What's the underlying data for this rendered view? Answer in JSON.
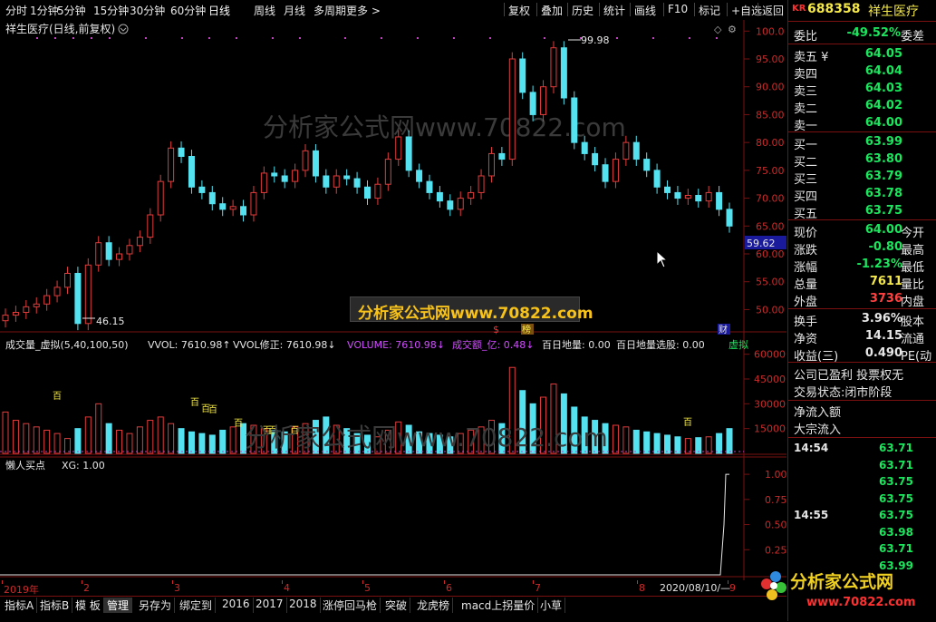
{
  "toolbar": {
    "left_items": [
      "分时",
      "1分钟",
      "5分钟",
      "15分钟",
      "30分钟",
      "60分钟",
      "日线",
      "周线",
      "月线",
      "多周期",
      "更多 >"
    ],
    "right_items": [
      "复权",
      "叠加",
      "历史",
      "统计",
      "画线",
      "F10",
      "标记",
      "+自选",
      "返回"
    ]
  },
  "main_chart": {
    "title": "祥生医疗(日线,前复权)",
    "y_ticks": [
      "100.0",
      "95.00",
      "90.00",
      "85.00",
      "80.00",
      "75.00",
      "70.00",
      "65.00",
      "60.00",
      "55.00",
      "50.00"
    ],
    "current_price_label": "59.62",
    "high_annotation": "99.98",
    "low_annotation": "46.15",
    "marker_dollar": "$",
    "marker_rank": "榜",
    "marker_cai": "财",
    "watermark_text": "分析家公式网www.70822.com"
  },
  "volume_chart": {
    "title": "成交量_虚拟(5,40,100,50)",
    "items": [
      {
        "text": "VVOL: 7610.98↑",
        "color": "#e6e6e6"
      },
      {
        "text": "VVOL修正: 7610.98↓",
        "color": "#e6e6e6"
      },
      {
        "text": "VOLUME: 7610.98↓",
        "color": "#d14cff"
      },
      {
        "text": "成交额_亿: 0.48↓",
        "color": "#d14cff"
      },
      {
        "text": "百日地量: 0.00",
        "color": "#e6e6e6"
      },
      {
        "text": "百日地量选股: 0.00",
        "color": "#e6e6e6"
      },
      {
        "text": "虚拟",
        "color": "#19e65c"
      }
    ],
    "y_ticks": [
      "60000",
      "45000",
      "30000",
      "15000"
    ],
    "marker_bai": "百"
  },
  "indicator_chart": {
    "title": "懒人买点",
    "value": "XG: 1.00",
    "y_ticks": [
      "1.00",
      "0.75",
      "0.50",
      "0.25"
    ]
  },
  "x_axis": {
    "labels": [
      "2019年",
      "2",
      "3",
      "4",
      "5",
      "6",
      "7",
      "8",
      "9"
    ],
    "cursor_date": "2020/08/10/—"
  },
  "chart_data": {
    "type": "candlestick",
    "title": "祥生医疗(日线,前复权)",
    "ylim": [
      46,
      102
    ],
    "close_series_approx": [
      49.0,
      49.5,
      50.5,
      51.0,
      52.5,
      54.0,
      56.5,
      47.5,
      58.0,
      62.0,
      59.0,
      60.0,
      61.5,
      63.0,
      67.0,
      73.0,
      79.0,
      77.5,
      72.0,
      71.0,
      69.0,
      68.0,
      68.5,
      67.0,
      71.0,
      74.5,
      74.0,
      73.0,
      75.0,
      78.5,
      74.0,
      72.0,
      74.0,
      73.5,
      72.0,
      70.0,
      72.5,
      77.0,
      81.0,
      75.0,
      73.0,
      71.0,
      69.5,
      68.0,
      70.0,
      71.0,
      74.0,
      78.0,
      77.0,
      95.0,
      89.0,
      85.0,
      90.0,
      97.0,
      88.0,
      80.0,
      78.0,
      76.0,
      73.0,
      77.0,
      80.0,
      77.0,
      75.0,
      72.0,
      71.0,
      70.0,
      70.5,
      69.5,
      71.0,
      68.0,
      65.0
    ],
    "volume_series_approx": [
      25000,
      20000,
      18000,
      16000,
      14000,
      12000,
      9000,
      15000,
      22000,
      30000,
      18000,
      14000,
      12000,
      16000,
      20000,
      22000,
      18000,
      15000,
      13000,
      12000,
      11000,
      14000,
      16000,
      18000,
      17000,
      15000,
      14000,
      13000,
      16000,
      18000,
      20000,
      22000,
      17000,
      15000,
      12000,
      11000,
      10000,
      14000,
      19000,
      17000,
      13000,
      12000,
      11000,
      10000,
      12000,
      14000,
      16000,
      20000,
      18000,
      52000,
      38000,
      30000,
      34000,
      42000,
      36000,
      28000,
      22000,
      20000,
      18000,
      17000,
      16000,
      14000,
      13000,
      12000,
      11000,
      10000,
      9000,
      9500,
      10000,
      12000,
      15000
    ],
    "indicator": {
      "name": "XG",
      "values_at_end": [
        0,
        0,
        0,
        1.0
      ],
      "ylim": [
        0,
        1.1
      ]
    }
  },
  "panel": {
    "code_prefix": "KR",
    "code": "688358",
    "name": "祥生医疗",
    "weibi_label": "委比",
    "weibi_value": "-49.52%",
    "weicha_label": "委差",
    "asks": [
      {
        "label": "卖五 ¥",
        "price": "64.05"
      },
      {
        "label": "卖四",
        "price": "64.04"
      },
      {
        "label": "卖三",
        "price": "64.03"
      },
      {
        "label": "卖二",
        "price": "64.02"
      },
      {
        "label": "卖一",
        "price": "64.00"
      }
    ],
    "bids": [
      {
        "label": "买一",
        "price": "63.99"
      },
      {
        "label": "买二",
        "price": "63.80"
      },
      {
        "label": "买三",
        "price": "63.79"
      },
      {
        "label": "买四",
        "price": "63.78"
      },
      {
        "label": "买五",
        "price": "63.75"
      }
    ],
    "stats": [
      {
        "label": "现价",
        "value": "64.00",
        "color": "#19e65c",
        "tail": "今开"
      },
      {
        "label": "涨跌",
        "value": "-0.80",
        "color": "#19e65c",
        "tail": "最高"
      },
      {
        "label": "涨幅",
        "value": "-1.23%",
        "color": "#19e65c",
        "tail": "最低"
      },
      {
        "label": "总量",
        "value": "7611",
        "color": "#f5e94a",
        "tail": "量比"
      },
      {
        "label": "外盘",
        "value": "3736",
        "color": "#ff4040",
        "tail": "内盘"
      }
    ],
    "stats2": [
      {
        "label": "换手",
        "value": "3.96%",
        "color": "#e6e6e6",
        "tail": "股本"
      },
      {
        "label": "净资",
        "value": "14.15",
        "color": "#e6e6e6",
        "tail": "流通"
      },
      {
        "label": "收益(三)",
        "value": "0.490",
        "color": "#e6e6e6",
        "tail": "PE(动"
      }
    ],
    "company_info": "公司已盈利 投票权无",
    "trade_status": "交易状态:闭市阶段",
    "net_inflow_label": "净流入额",
    "block_inflow_label": "大宗流入",
    "ticks": [
      {
        "time": "14:54",
        "price": "63.71"
      },
      {
        "time": "",
        "price": "63.71"
      },
      {
        "time": "",
        "price": "63.75"
      },
      {
        "time": "",
        "price": "63.75"
      },
      {
        "time": "14:55",
        "price": "63.75"
      },
      {
        "time": "",
        "price": "63.98"
      },
      {
        "time": "",
        "price": "63.71"
      },
      {
        "time": "",
        "price": "63.99"
      }
    ]
  },
  "bottom_tabs": [
    "指标A",
    "指标B",
    "模 板",
    "管理",
    "另存为",
    "绑定到",
    "2016",
    "2017",
    "2018",
    "涨停回马枪",
    "突破",
    "龙虎榜",
    "macd上拐量价",
    "小草"
  ],
  "logo": {
    "text": "分析家公式网",
    "url": "www.70822.com"
  }
}
